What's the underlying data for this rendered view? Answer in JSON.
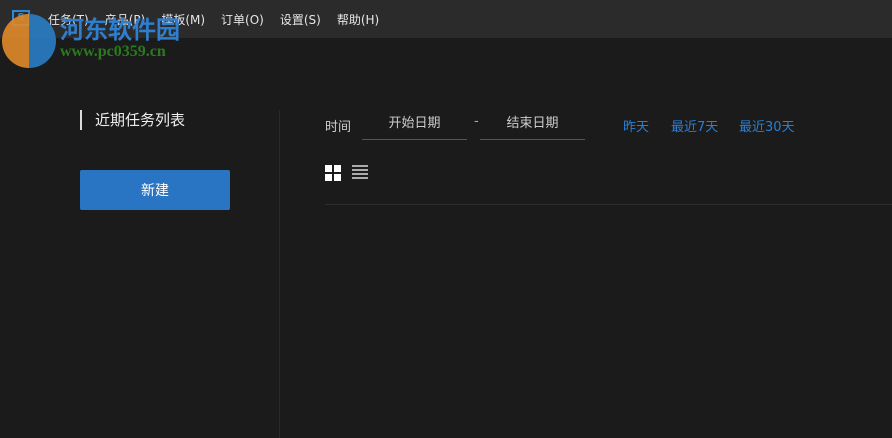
{
  "menubar": {
    "items": [
      "任务(T)",
      "产品(P)",
      "模板(M)",
      "订单(O)",
      "设置(S)",
      "帮助(H)"
    ]
  },
  "watermark": {
    "title": "河东软件园",
    "url": "www.pc0359.cn"
  },
  "sidebar": {
    "title": "近期任务列表",
    "new_button": "新建"
  },
  "filter": {
    "time_label": "时间",
    "start_placeholder": "开始日期",
    "separator": "-",
    "end_placeholder": "结束日期",
    "quick": [
      "昨天",
      "最近7天",
      "最近30天"
    ]
  },
  "colors": {
    "accent": "#2a74c4",
    "link": "#2a7fd4",
    "background": "#1b1b1b"
  }
}
